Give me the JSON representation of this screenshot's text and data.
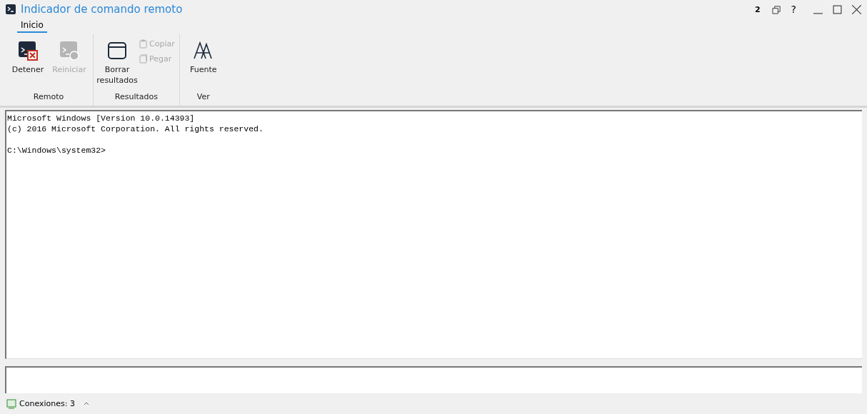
{
  "window": {
    "title": "Indicador de comando remoto",
    "badge": "2",
    "help": "?"
  },
  "tabs": [
    {
      "label": "Inicio",
      "selected": true
    }
  ],
  "ribbon": [
    {
      "label": "Remoto",
      "items": [
        {
          "kind": "large",
          "label": "Detener",
          "disabled": false
        },
        {
          "kind": "large",
          "label": "Reiniciar",
          "disabled": true
        }
      ]
    },
    {
      "label": "Resultados",
      "items": [
        {
          "kind": "large",
          "label": "Borrar resultados",
          "disabled": false
        },
        {
          "kind": "small",
          "label": "Copiar",
          "disabled": true
        },
        {
          "kind": "small",
          "label": "Pegar",
          "disabled": true
        }
      ]
    },
    {
      "label": "Ver",
      "items": [
        {
          "kind": "large",
          "label": "Fuente",
          "disabled": false
        }
      ]
    }
  ],
  "console": {
    "blocks": [
      {
        "lines": [
          "Microsoft Windows [Version 10.0.14393]",
          "(c) 2016 Microsoft Corporation. All rights reserved."
        ]
      },
      {
        "lines": [
          "C:\\Windows\\system32>"
        ]
      }
    ]
  },
  "status_bar": {
    "connections": "Conexiones: 3"
  }
}
